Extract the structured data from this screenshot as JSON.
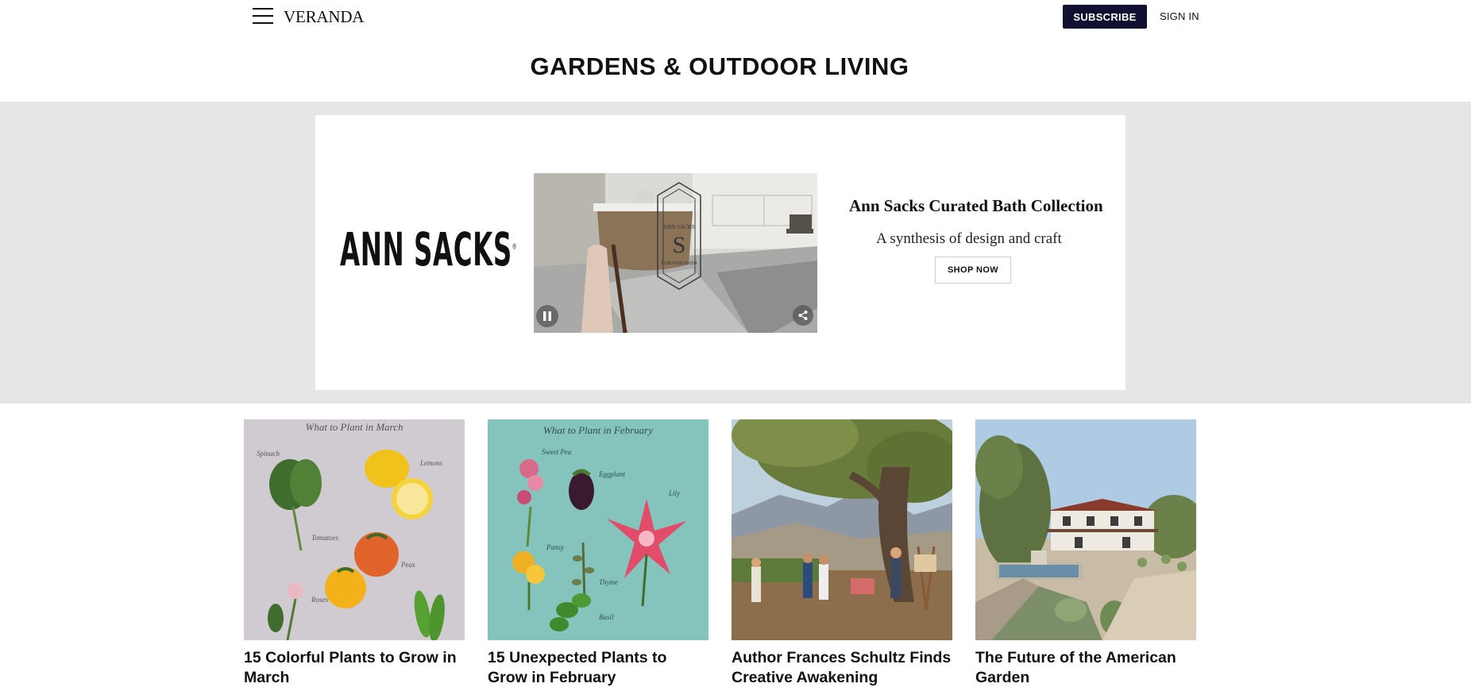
{
  "header": {
    "logo": "VERANDA",
    "subscribe_label": "SUBSCRIBE",
    "signin_label": "SIGN IN"
  },
  "page_title": "GARDENS & OUTDOOR LIVING",
  "ad": {
    "brand": "ANN SACKS",
    "brand_mark": "®",
    "headline": "Ann Sacks Curated Bath Collection",
    "subheadline": "A synthesis of design and craft",
    "cta": "SHOP NOW",
    "image_emblem": "ANN SACKS",
    "image_emblem_sub": "CURATED BATH"
  },
  "articles": [
    {
      "title": "15 Colorful Plants to Grow in March",
      "image_caption": "What to Plant in March",
      "image_labels": [
        "Spinach",
        "Lemons",
        "Tomatoes",
        "Peas",
        "Roses"
      ]
    },
    {
      "title": "15 Unexpected Plants to Grow in February",
      "image_caption": "What to Plant in February",
      "image_labels": [
        "Sweet Pea",
        "Eggplant",
        "Lily",
        "Pansy",
        "Thyme",
        "Basil"
      ]
    },
    {
      "title": "Author Frances Schultz Finds Creative Awakening"
    },
    {
      "title": "The Future of the American Garden"
    }
  ],
  "colors": {
    "subscribe_bg": "#111031",
    "ad_band": "#e6e6e6",
    "march_bg": "#cfcbd0",
    "february_bg": "#84c4bd"
  }
}
